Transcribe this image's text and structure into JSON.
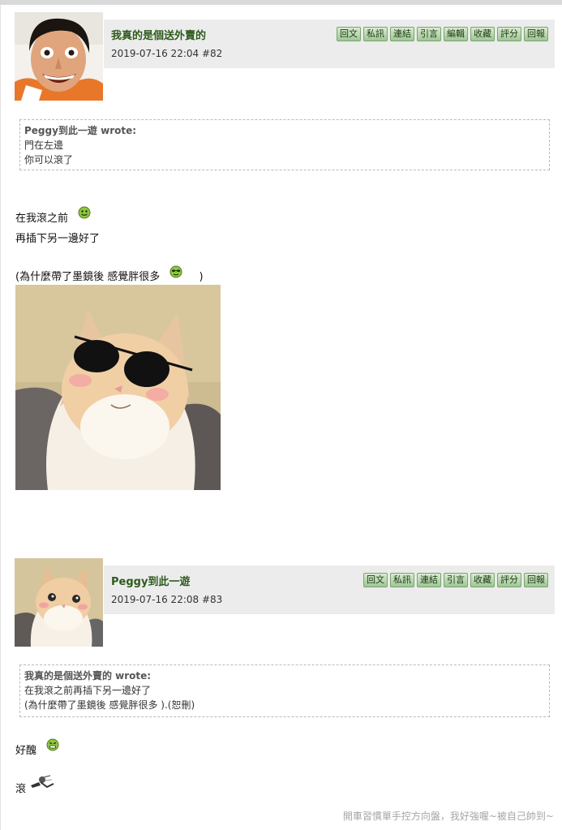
{
  "posts": [
    {
      "author": "我真的是個送外賣的",
      "meta": "2019-07-16 22:04  #82",
      "actions": [
        "回文",
        "私訊",
        "連結",
        "引言",
        "編輯",
        "收藏",
        "評分",
        "回報"
      ],
      "quote": {
        "head": "Peggy到此一遊 wrote:",
        "lines": [
          "門在左邊",
          "你可以滾了"
        ]
      },
      "body": {
        "line1": "在我滾之前",
        "line2": "再插下另一邊好了",
        "line3_open": "(為什麼帶了墨鏡後 感覺胖很多",
        "line3_close": ")"
      },
      "emoticons": [
        "smile-face-icon",
        "sunglasses-face-icon"
      ]
    },
    {
      "author": "Peggy到此一遊",
      "meta": "2019-07-16 22:08  #83",
      "actions": [
        "回文",
        "私訊",
        "連結",
        "引言",
        "收藏",
        "評分",
        "回報"
      ],
      "quote": {
        "head": "我真的是個送外賣的 wrote:",
        "lines": [
          "在我滾之前再插下另一邊好了",
          "(為什麼帶了墨鏡後 感覺胖很多 ).(恕刪)"
        ]
      },
      "body": {
        "line1": "好醜",
        "line2": "滾"
      },
      "emoticons": [
        "grin-face-icon",
        "kick-icon"
      ]
    }
  ],
  "signature": "開車習慣單手控方向盤，我好強喔~被自己帥到~",
  "colors": {
    "accent": "#2d5a1c",
    "button_bg": "#b9d9b0",
    "header_bg": "#ececec"
  }
}
